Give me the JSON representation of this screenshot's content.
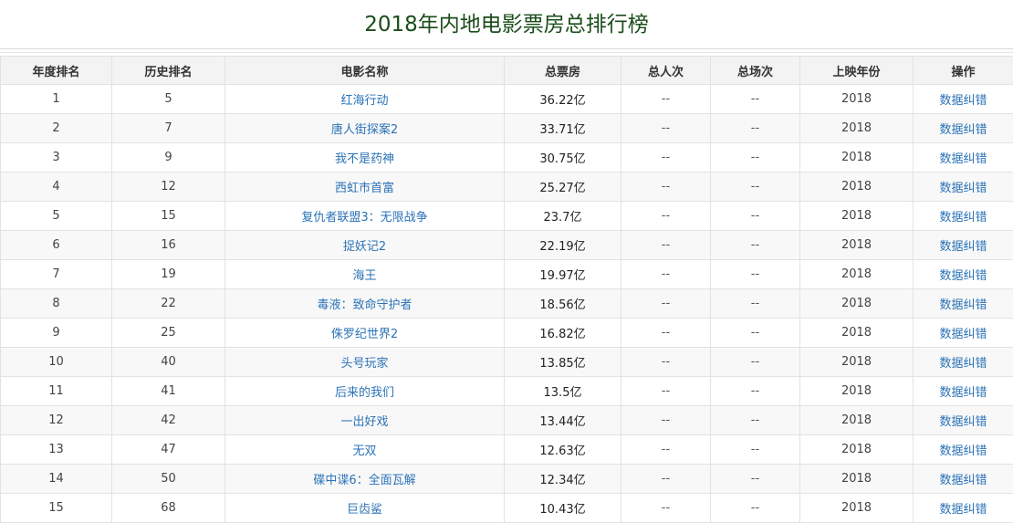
{
  "page": {
    "title": "2018年内地电影票房总排行榜"
  },
  "table": {
    "headers": [
      "年度排名",
      "历史排名",
      "电影名称",
      "总票房",
      "总人次",
      "总场次",
      "上映年份",
      "操作"
    ],
    "rows": [
      {
        "annual_rank": "1",
        "history_rank": "5",
        "movie": "红海行动",
        "gross": "36.22亿",
        "admissions": "--",
        "screenings": "--",
        "year": "2018",
        "action": "数据纠错"
      },
      {
        "annual_rank": "2",
        "history_rank": "7",
        "movie": "唐人街探案2",
        "gross": "33.71亿",
        "admissions": "--",
        "screenings": "--",
        "year": "2018",
        "action": "数据纠错"
      },
      {
        "annual_rank": "3",
        "history_rank": "9",
        "movie": "我不是药神",
        "gross": "30.75亿",
        "admissions": "--",
        "screenings": "--",
        "year": "2018",
        "action": "数据纠错"
      },
      {
        "annual_rank": "4",
        "history_rank": "12",
        "movie": "西虹市首富",
        "gross": "25.27亿",
        "admissions": "--",
        "screenings": "--",
        "year": "2018",
        "action": "数据纠错"
      },
      {
        "annual_rank": "5",
        "history_rank": "15",
        "movie": "复仇者联盟3：无限战争",
        "gross": "23.7亿",
        "admissions": "--",
        "screenings": "--",
        "year": "2018",
        "action": "数据纠错"
      },
      {
        "annual_rank": "6",
        "history_rank": "16",
        "movie": "捉妖记2",
        "gross": "22.19亿",
        "admissions": "--",
        "screenings": "--",
        "year": "2018",
        "action": "数据纠错"
      },
      {
        "annual_rank": "7",
        "history_rank": "19",
        "movie": "海王",
        "gross": "19.97亿",
        "admissions": "--",
        "screenings": "--",
        "year": "2018",
        "action": "数据纠错"
      },
      {
        "annual_rank": "8",
        "history_rank": "22",
        "movie": "毒液：致命守护者",
        "gross": "18.56亿",
        "admissions": "--",
        "screenings": "--",
        "year": "2018",
        "action": "数据纠错"
      },
      {
        "annual_rank": "9",
        "history_rank": "25",
        "movie": "侏罗纪世界2",
        "gross": "16.82亿",
        "admissions": "--",
        "screenings": "--",
        "year": "2018",
        "action": "数据纠错"
      },
      {
        "annual_rank": "10",
        "history_rank": "40",
        "movie": "头号玩家",
        "gross": "13.85亿",
        "admissions": "--",
        "screenings": "--",
        "year": "2018",
        "action": "数据纠错"
      },
      {
        "annual_rank": "11",
        "history_rank": "41",
        "movie": "后来的我们",
        "gross": "13.5亿",
        "admissions": "--",
        "screenings": "--",
        "year": "2018",
        "action": "数据纠错"
      },
      {
        "annual_rank": "12",
        "history_rank": "42",
        "movie": "一出好戏",
        "gross": "13.44亿",
        "admissions": "--",
        "screenings": "--",
        "year": "2018",
        "action": "数据纠错"
      },
      {
        "annual_rank": "13",
        "history_rank": "47",
        "movie": "无双",
        "gross": "12.63亿",
        "admissions": "--",
        "screenings": "--",
        "year": "2018",
        "action": "数据纠错"
      },
      {
        "annual_rank": "14",
        "history_rank": "50",
        "movie": "碟中谍6：全面瓦解",
        "gross": "12.34亿",
        "admissions": "--",
        "screenings": "--",
        "year": "2018",
        "action": "数据纠错"
      },
      {
        "annual_rank": "15",
        "history_rank": "68",
        "movie": "巨齿鲨",
        "gross": "10.43亿",
        "admissions": "--",
        "screenings": "--",
        "year": "2018",
        "action": "数据纠错"
      }
    ]
  },
  "colors": {
    "title": "#1a4d1a",
    "link": "#2b73b7",
    "header_bg": "#f3f3f3",
    "alt_row_bg": "#f8f8f8",
    "border": "#e2e2e2"
  }
}
